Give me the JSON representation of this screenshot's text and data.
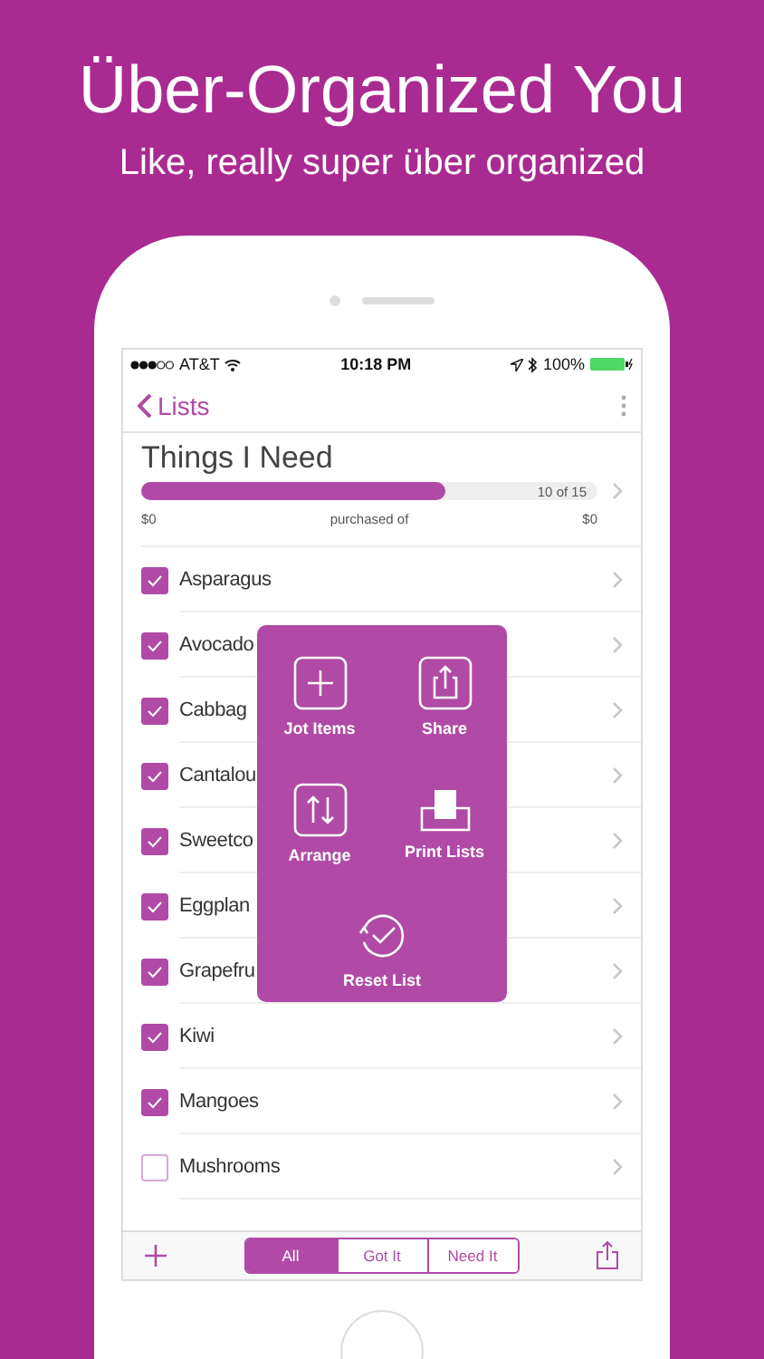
{
  "headline": "Über-Organized You",
  "subtitle": "Like, really super über organized",
  "status_bar": {
    "carrier": "AT&T",
    "time": "10:18 PM",
    "battery": "100%"
  },
  "nav": {
    "back": "Lists"
  },
  "list": {
    "title": "Things I Need",
    "progress": {
      "level": 0.667,
      "count": "10 of 15"
    },
    "spent": "$0",
    "caption": "purchased of",
    "total": "$0"
  },
  "items": [
    {
      "name": "Asparagus",
      "checked": true
    },
    {
      "name": "Avocado",
      "checked": true
    },
    {
      "name": "Cabbag",
      "checked": true
    },
    {
      "name": "Cantalou",
      "checked": true
    },
    {
      "name": "Sweetco",
      "checked": true
    },
    {
      "name": "Eggplan",
      "checked": true
    },
    {
      "name": "Grapefru",
      "checked": true
    },
    {
      "name": "Kiwi",
      "checked": true
    },
    {
      "name": "Mangoes",
      "checked": true
    },
    {
      "name": "Mushrooms",
      "checked": false
    }
  ],
  "menu": [
    {
      "label": "Jot Items",
      "kind": "add"
    },
    {
      "label": "Share",
      "kind": "share"
    },
    {
      "label": "Arrange",
      "kind": "arrange"
    },
    {
      "label": "Print Lists",
      "kind": "print"
    },
    {
      "label": "Reset List",
      "kind": "reset"
    }
  ],
  "toolbar": {
    "segments": [
      {
        "label": "All",
        "selected": true
      },
      {
        "label": "Got It",
        "selected": false
      },
      {
        "label": "Need It",
        "selected": false
      }
    ]
  }
}
